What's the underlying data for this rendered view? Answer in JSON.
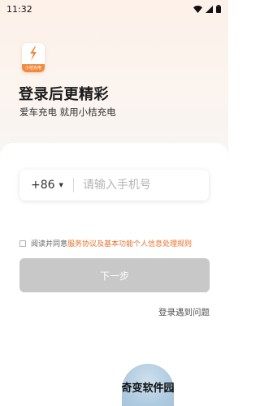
{
  "status_bar": {
    "time": "11:32",
    "icons": [
      "wifi-icon",
      "signal-icon",
      "battery-icon"
    ]
  },
  "logo": {
    "icon": "lightning-bolt-icon",
    "text": "小桔充电",
    "brand_color": "#f08a3e"
  },
  "header": {
    "title": "登录后更精彩",
    "subtitle": "爱车充电 就用小桔充电"
  },
  "phone": {
    "country_code": "+86",
    "caret": "▼",
    "placeholder": "请输入手机号",
    "value": ""
  },
  "agreement": {
    "checked": false,
    "prefix": "阅读并同意",
    "link_text": "服务协议及基本功能个人信息处理规则",
    "link_color": "#e8702a"
  },
  "next_button": {
    "label": "下一步",
    "disabled": true,
    "color": "#c8c8c8"
  },
  "help_link": {
    "label": "登录遇到问题"
  },
  "watermark": {
    "text": "奇变软件园"
  }
}
